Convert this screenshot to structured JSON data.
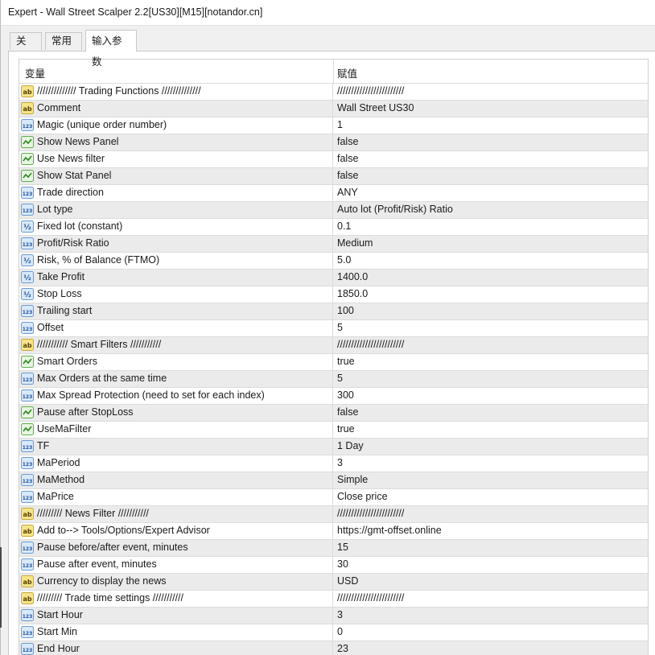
{
  "window": {
    "title": "Expert - Wall Street Scalper 2.2[US30][M15][notandor.cn]"
  },
  "tabs": [
    {
      "label": "关于",
      "active": false
    },
    {
      "label": "常用",
      "active": false
    },
    {
      "label": "输入参数",
      "active": true
    }
  ],
  "table": {
    "columns": {
      "variable": "变量",
      "value": "赋值"
    },
    "rows": [
      {
        "icon": "ab",
        "name": "////////////// Trading Functions //////////////",
        "value": "////////////////////////"
      },
      {
        "icon": "ab",
        "name": "Comment",
        "value": "Wall Street US30"
      },
      {
        "icon": "123",
        "name": "Magic (unique order number)",
        "value": "1"
      },
      {
        "icon": "bool",
        "name": "Show News Panel",
        "value": "false"
      },
      {
        "icon": "bool",
        "name": "Use News filter",
        "value": "false"
      },
      {
        "icon": "bool",
        "name": "Show Stat Panel",
        "value": "false"
      },
      {
        "icon": "123",
        "name": "Trade direction",
        "value": "ANY"
      },
      {
        "icon": "123",
        "name": "Lot type",
        "value": "Auto lot (Profit/Risk) Ratio"
      },
      {
        "icon": "v2",
        "name": "Fixed lot (constant)",
        "value": "0.1"
      },
      {
        "icon": "123",
        "name": "Profit/Risk Ratio",
        "value": "Medium"
      },
      {
        "icon": "v2",
        "name": "Risk, % of Balance (FTMO)",
        "value": "5.0"
      },
      {
        "icon": "v2",
        "name": "Take Profit",
        "value": "1400.0"
      },
      {
        "icon": "v2",
        "name": "Stop Loss",
        "value": "1850.0"
      },
      {
        "icon": "123",
        "name": "Trailing start",
        "value": "100"
      },
      {
        "icon": "123",
        "name": "Offset",
        "value": "5"
      },
      {
        "icon": "ab",
        "name": "/////////// Smart Filters ///////////",
        "value": "////////////////////////"
      },
      {
        "icon": "bool",
        "name": "Smart Orders",
        "value": "true"
      },
      {
        "icon": "123",
        "name": "Max Orders at the same time",
        "value": "5"
      },
      {
        "icon": "123",
        "name": "Max Spread Protection (need to set for each index)",
        "value": "300"
      },
      {
        "icon": "bool",
        "name": "Pause after StopLoss",
        "value": "false"
      },
      {
        "icon": "bool",
        "name": "UseMaFilter",
        "value": "true"
      },
      {
        "icon": "123",
        "name": "TF",
        "value": "1 Day"
      },
      {
        "icon": "123",
        "name": "MaPeriod",
        "value": "3"
      },
      {
        "icon": "123",
        "name": "MaMethod",
        "value": "Simple"
      },
      {
        "icon": "123",
        "name": "MaPrice",
        "value": "Close price"
      },
      {
        "icon": "ab",
        "name": "///////// News Filter ///////////",
        "value": "////////////////////////"
      },
      {
        "icon": "ab",
        "name": "Add to--> Tools/Options/Expert Advisor",
        "value": "https://gmt-offset.online"
      },
      {
        "icon": "123",
        "name": "Pause before/after event, minutes",
        "value": "15"
      },
      {
        "icon": "123",
        "name": "Pause after event, minutes",
        "value": "30"
      },
      {
        "icon": "ab",
        "name": "Currency to display the news",
        "value": "USD"
      },
      {
        "icon": "ab",
        "name": "///////// Trade time settings ///////////",
        "value": "////////////////////////"
      },
      {
        "icon": "123",
        "name": "Start Hour",
        "value": "3"
      },
      {
        "icon": "123",
        "name": "Start Min",
        "value": "0"
      },
      {
        "icon": "123",
        "name": "End Hour",
        "value": "23"
      }
    ]
  },
  "icons": {
    "ab": {
      "semantic": "string-type-icon",
      "text": "ab",
      "bg": "#f6e48a",
      "border": "#c9a93a",
      "fg": "#5a4200"
    },
    "123": {
      "semantic": "integer-type-icon",
      "text": "123",
      "bg": "#d7e9fb",
      "border": "#6d9cd0",
      "fg": "#1f4f9a"
    },
    "v2": {
      "semantic": "double-type-icon",
      "text": "½",
      "bg": "#d7e9fb",
      "border": "#6d9cd0",
      "fg": "#1f4f9a"
    },
    "bool": {
      "semantic": "boolean-type-icon",
      "text": "",
      "bg": "#e6f6e0",
      "border": "#5fae4a",
      "fg": "#2d8a1f"
    }
  }
}
